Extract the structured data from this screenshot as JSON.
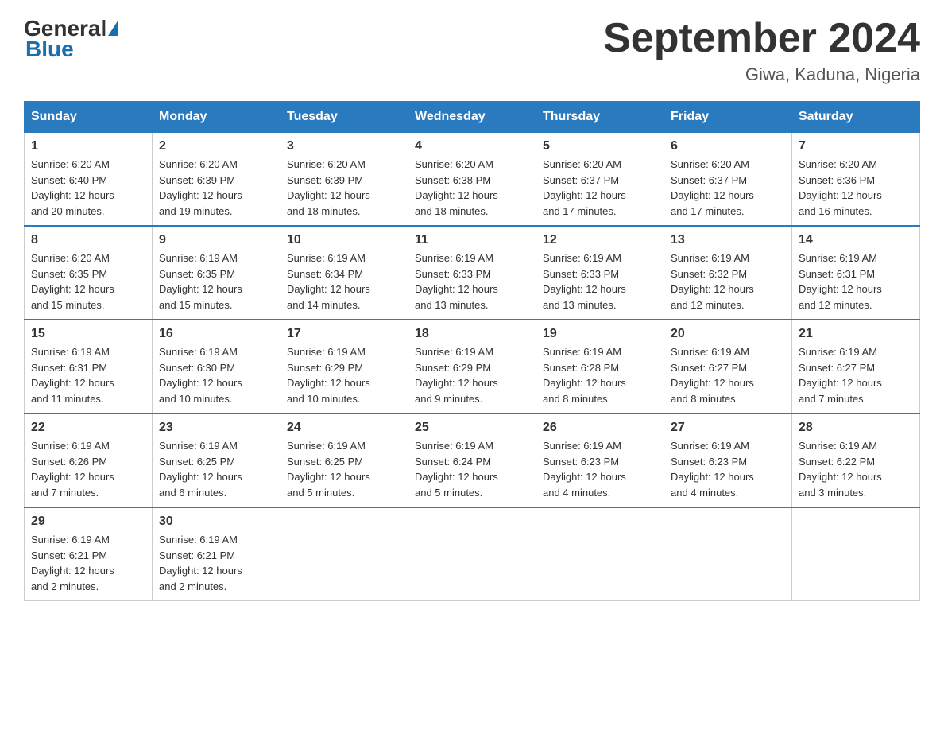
{
  "logo": {
    "text_general": "General",
    "text_blue": "Blue",
    "triangle_label": "logo-triangle"
  },
  "header": {
    "title": "September 2024",
    "subtitle": "Giwa, Kaduna, Nigeria"
  },
  "weekdays": [
    "Sunday",
    "Monday",
    "Tuesday",
    "Wednesday",
    "Thursday",
    "Friday",
    "Saturday"
  ],
  "weeks": [
    [
      {
        "day": "1",
        "sunrise": "6:20 AM",
        "sunset": "6:40 PM",
        "daylight": "12 hours and 20 minutes."
      },
      {
        "day": "2",
        "sunrise": "6:20 AM",
        "sunset": "6:39 PM",
        "daylight": "12 hours and 19 minutes."
      },
      {
        "day": "3",
        "sunrise": "6:20 AM",
        "sunset": "6:39 PM",
        "daylight": "12 hours and 18 minutes."
      },
      {
        "day": "4",
        "sunrise": "6:20 AM",
        "sunset": "6:38 PM",
        "daylight": "12 hours and 18 minutes."
      },
      {
        "day": "5",
        "sunrise": "6:20 AM",
        "sunset": "6:37 PM",
        "daylight": "12 hours and 17 minutes."
      },
      {
        "day": "6",
        "sunrise": "6:20 AM",
        "sunset": "6:37 PM",
        "daylight": "12 hours and 17 minutes."
      },
      {
        "day": "7",
        "sunrise": "6:20 AM",
        "sunset": "6:36 PM",
        "daylight": "12 hours and 16 minutes."
      }
    ],
    [
      {
        "day": "8",
        "sunrise": "6:20 AM",
        "sunset": "6:35 PM",
        "daylight": "12 hours and 15 minutes."
      },
      {
        "day": "9",
        "sunrise": "6:19 AM",
        "sunset": "6:35 PM",
        "daylight": "12 hours and 15 minutes."
      },
      {
        "day": "10",
        "sunrise": "6:19 AM",
        "sunset": "6:34 PM",
        "daylight": "12 hours and 14 minutes."
      },
      {
        "day": "11",
        "sunrise": "6:19 AM",
        "sunset": "6:33 PM",
        "daylight": "12 hours and 13 minutes."
      },
      {
        "day": "12",
        "sunrise": "6:19 AM",
        "sunset": "6:33 PM",
        "daylight": "12 hours and 13 minutes."
      },
      {
        "day": "13",
        "sunrise": "6:19 AM",
        "sunset": "6:32 PM",
        "daylight": "12 hours and 12 minutes."
      },
      {
        "day": "14",
        "sunrise": "6:19 AM",
        "sunset": "6:31 PM",
        "daylight": "12 hours and 12 minutes."
      }
    ],
    [
      {
        "day": "15",
        "sunrise": "6:19 AM",
        "sunset": "6:31 PM",
        "daylight": "12 hours and 11 minutes."
      },
      {
        "day": "16",
        "sunrise": "6:19 AM",
        "sunset": "6:30 PM",
        "daylight": "12 hours and 10 minutes."
      },
      {
        "day": "17",
        "sunrise": "6:19 AM",
        "sunset": "6:29 PM",
        "daylight": "12 hours and 10 minutes."
      },
      {
        "day": "18",
        "sunrise": "6:19 AM",
        "sunset": "6:29 PM",
        "daylight": "12 hours and 9 minutes."
      },
      {
        "day": "19",
        "sunrise": "6:19 AM",
        "sunset": "6:28 PM",
        "daylight": "12 hours and 8 minutes."
      },
      {
        "day": "20",
        "sunrise": "6:19 AM",
        "sunset": "6:27 PM",
        "daylight": "12 hours and 8 minutes."
      },
      {
        "day": "21",
        "sunrise": "6:19 AM",
        "sunset": "6:27 PM",
        "daylight": "12 hours and 7 minutes."
      }
    ],
    [
      {
        "day": "22",
        "sunrise": "6:19 AM",
        "sunset": "6:26 PM",
        "daylight": "12 hours and 7 minutes."
      },
      {
        "day": "23",
        "sunrise": "6:19 AM",
        "sunset": "6:25 PM",
        "daylight": "12 hours and 6 minutes."
      },
      {
        "day": "24",
        "sunrise": "6:19 AM",
        "sunset": "6:25 PM",
        "daylight": "12 hours and 5 minutes."
      },
      {
        "day": "25",
        "sunrise": "6:19 AM",
        "sunset": "6:24 PM",
        "daylight": "12 hours and 5 minutes."
      },
      {
        "day": "26",
        "sunrise": "6:19 AM",
        "sunset": "6:23 PM",
        "daylight": "12 hours and 4 minutes."
      },
      {
        "day": "27",
        "sunrise": "6:19 AM",
        "sunset": "6:23 PM",
        "daylight": "12 hours and 4 minutes."
      },
      {
        "day": "28",
        "sunrise": "6:19 AM",
        "sunset": "6:22 PM",
        "daylight": "12 hours and 3 minutes."
      }
    ],
    [
      {
        "day": "29",
        "sunrise": "6:19 AM",
        "sunset": "6:21 PM",
        "daylight": "12 hours and 2 minutes."
      },
      {
        "day": "30",
        "sunrise": "6:19 AM",
        "sunset": "6:21 PM",
        "daylight": "12 hours and 2 minutes."
      },
      null,
      null,
      null,
      null,
      null
    ]
  ]
}
